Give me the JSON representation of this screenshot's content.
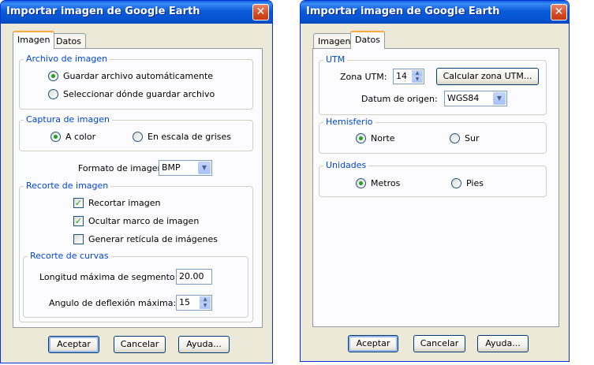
{
  "dialog1": {
    "title": "Importar imagen de Google Earth",
    "close_glyph": "✕",
    "tabs": [
      "Imagen",
      "Datos"
    ],
    "active_tab": "Imagen",
    "archivo": {
      "legend": "Archivo de imagen",
      "options": [
        "Guardar archivo automáticamente",
        "Seleccionar dónde guardar archivo"
      ],
      "selected": 0
    },
    "captura": {
      "legend": "Captura de imagen",
      "options": [
        "A color",
        "En escala de grises"
      ],
      "selected": 0
    },
    "formato": {
      "label": "Formato de imagen:",
      "value": "BMP"
    },
    "recorte": {
      "legend": "Recorte de imagen",
      "checks": [
        {
          "label": "Recortar imagen",
          "checked": true
        },
        {
          "label": "Ocultar marco de imagen",
          "checked": true
        },
        {
          "label": "Generar retícula de imágenes",
          "checked": false
        }
      ]
    },
    "curvas": {
      "legend": "Recorte de curvas",
      "segmento_label": "Longitud máxima de segmento:",
      "segmento_value": "20.00",
      "angulo_label": "Angulo de deflexión máxima:",
      "angulo_value": "15"
    },
    "buttons": {
      "ok": "Aceptar",
      "cancel": "Cancelar",
      "help": "Ayuda..."
    }
  },
  "dialog2": {
    "title": "Importar imagen de Google Earth",
    "close_glyph": "✕",
    "tabs": [
      "Imagen",
      "Datos"
    ],
    "active_tab": "Datos",
    "utm": {
      "legend": "UTM",
      "zona_label": "Zona UTM:",
      "zona_value": "14",
      "calc_button": "Calcular zona UTM...",
      "datum_label": "Datum de origen:",
      "datum_value": "WGS84"
    },
    "hemisferio": {
      "legend": "Hemisferio",
      "options": [
        "Norte",
        "Sur"
      ],
      "selected": 0
    },
    "unidades": {
      "legend": "Unidades",
      "options": [
        "Metros",
        "Pies"
      ],
      "selected": 0
    },
    "buttons": {
      "ok": "Aceptar",
      "cancel": "Cancelar",
      "help": "Ayuda..."
    }
  },
  "icons": {
    "close": "close-icon",
    "dropdown": "chevron-down-icon",
    "spin": "spin-arrows-icon"
  },
  "colors": {
    "titlebar": "#0a5bd8",
    "legend_text": "#0046d5",
    "dialog_bg": "#ece9d8",
    "tab_highlight": "#f9a93d"
  }
}
